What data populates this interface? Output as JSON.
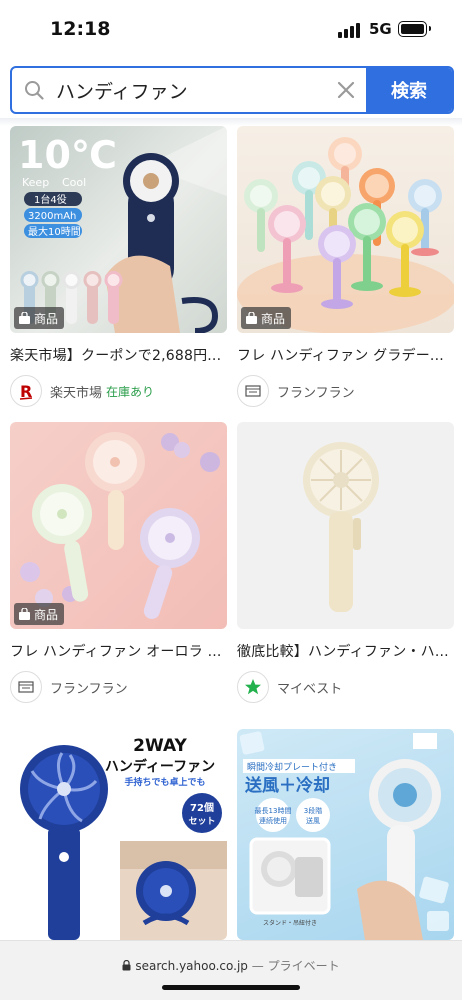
{
  "status": {
    "time": "12:18",
    "network": "5G"
  },
  "search": {
    "query": "ハンディファン",
    "button_label": "検索"
  },
  "results": [
    {
      "badge": "商品",
      "title": "楽天市場】クーポンで2,688円...",
      "shop": "楽天市場",
      "stock": "在庫あり",
      "shop_icon": "rakuten-logo"
    },
    {
      "badge": "商品",
      "title": "フレ ハンディファン グラデー...",
      "shop": "フランフラン",
      "stock": "",
      "shop_icon": "francfranc-logo"
    },
    {
      "badge": "商品",
      "title": "フレ ハンディファン オーロラ ...",
      "shop": "フランフラン",
      "stock": "",
      "shop_icon": "francfranc-logo"
    },
    {
      "badge": "",
      "title": "徹底比較】ハンディファン・ハ...",
      "shop": "マイベスト",
      "stock": "",
      "shop_icon": "mybest-star-logo"
    },
    {
      "badge": "",
      "title": "",
      "shop": "",
      "stock": "",
      "shop_icon": ""
    },
    {
      "badge": "",
      "title": "",
      "shop": "",
      "stock": "",
      "shop_icon": ""
    }
  ],
  "images": {
    "r1": {
      "big": "10℃",
      "keep": "Keep",
      "cool": "Cool",
      "l1": "1台4役",
      "l2": "3200mAh",
      "l3": "最大10時間"
    },
    "r5": {
      "t1": "2WAY",
      "t2": "ハンディーファン",
      "t3": "手持ちでも卓上でも",
      "c1": "72個",
      "c2": "セット"
    },
    "r6": {
      "s0": "瞬間冷却プレート付き",
      "s1": "送風＋冷却",
      "s2": "最長13時間",
      "s2b": "連続使用",
      "s3": "3段階",
      "s3b": "送風",
      "s4": "スタンド・吊紐付き"
    }
  },
  "browser": {
    "domain": "search.yahoo.co.jp",
    "separator": "—",
    "mode": "プライベート"
  },
  "colors": {
    "accent": "#2f6fdf",
    "stock_green": "#2a9d4a",
    "rakuten_red": "#bf0000",
    "mybest_green": "#22b14c"
  }
}
